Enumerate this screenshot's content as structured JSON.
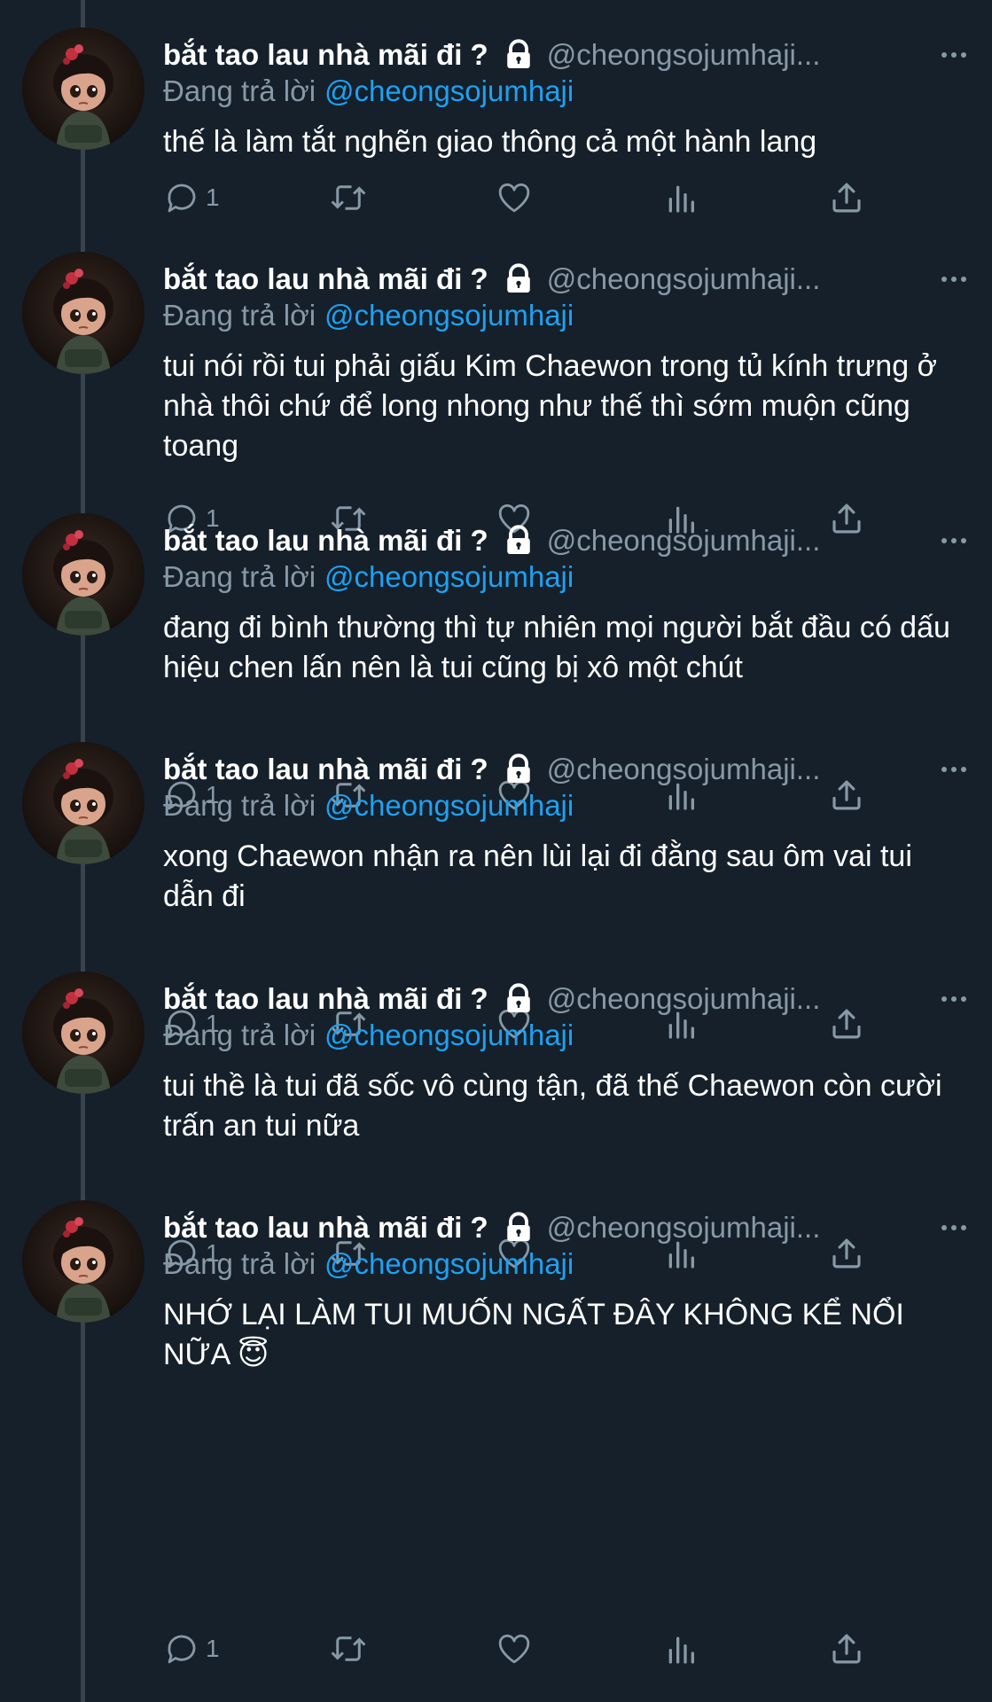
{
  "thread": {
    "tweets": [
      {
        "name": "bắt tao lau nhà mãi đi ?",
        "handle": "@cheongsojumhaji...",
        "reply_prefix": "Đang trả lời",
        "reply_to": "@cheongsojumhaji",
        "text": "thế là làm tắt nghẽn giao thông cả một hành lang",
        "reply_count": "1"
      },
      {
        "name": "bắt tao lau nhà mãi đi ?",
        "handle": "@cheongsojumhaji...",
        "reply_prefix": "Đang trả lời",
        "reply_to": "@cheongsojumhaji",
        "text": "tui nói rồi tui phải giấu Kim Chaewon trong tủ kính trưng ở nhà thôi chứ để long nhong như thế thì sớm muộn cũng toang",
        "reply_count": "1"
      },
      {
        "name": "bắt tao lau nhà mãi đi ?",
        "handle": "@cheongsojumhaji...",
        "reply_prefix": "Đang trả lời",
        "reply_to": "@cheongsojumhaji",
        "text": "đang đi bình thường thì tự nhiên mọi người bắt đầu có dấu hiệu chen lấn nên là tui cũng bị xô một chút",
        "reply_count": "1"
      },
      {
        "name": "bắt tao lau nhà mãi đi ?",
        "handle": "@cheongsojumhaji...",
        "reply_prefix": "Đang trả lời",
        "reply_to": "@cheongsojumhaji",
        "text": "xong Chaewon nhận ra nên lùi lại đi đằng sau ôm vai tui dẫn đi",
        "reply_count": "1"
      },
      {
        "name": "bắt tao lau nhà mãi đi ?",
        "handle": "@cheongsojumhaji...",
        "reply_prefix": "Đang trả lời",
        "reply_to": "@cheongsojumhaji",
        "text": "tui thề là tui đã sốc vô cùng tận, đã thế Chaewon còn cười trấn an tui nữa",
        "reply_count": "1"
      },
      {
        "name": "bắt tao lau nhà mãi đi ?",
        "handle": "@cheongsojumhaji...",
        "reply_prefix": "Đang trả lời",
        "reply_to": "@cheongsojumhaji",
        "text": "NHỚ LẠI LÀM TUI MUỐN NGẤT ĐÂY KHÔNG KỂ NỔI NỮA 😇",
        "reply_count": "1"
      }
    ]
  },
  "colors": {
    "background": "#15202b",
    "primary_text": "#ffffff",
    "secondary_text": "#8899a6",
    "link": "#1da1f2",
    "thread_line": "#38444d"
  },
  "icons": [
    "lock-icon",
    "more-icon",
    "reply-icon",
    "retweet-icon",
    "like-icon",
    "analytics-icon",
    "share-icon"
  ]
}
